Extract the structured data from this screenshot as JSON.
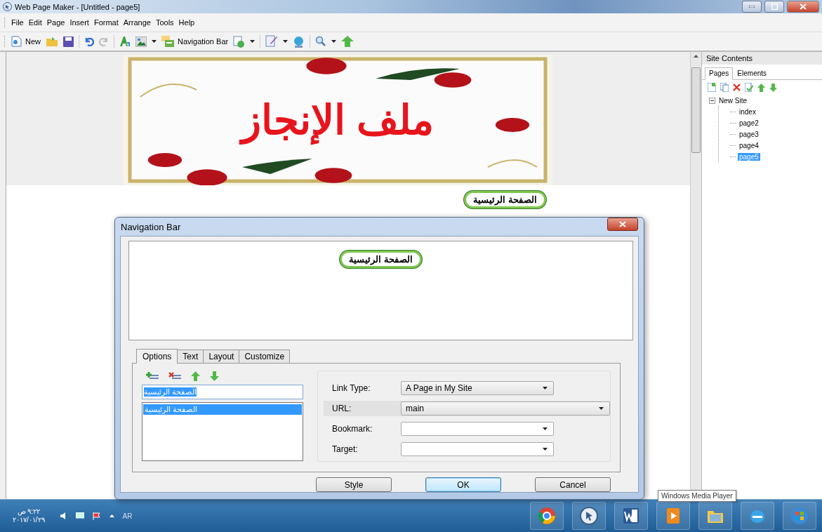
{
  "window": {
    "title": "Web Page Maker - [Untitled - page5]"
  },
  "menu": [
    "File",
    "Edit",
    "Page",
    "Insert",
    "Format",
    "Arrange",
    "Tools",
    "Help"
  ],
  "toolbar": {
    "new_label": "New",
    "navbar_label": "Navigation Bar"
  },
  "page": {
    "banner_title": "ملف الإنجاز",
    "nav_button": "الصفحة الرئيسية"
  },
  "site_panel": {
    "title": "Site Contents",
    "tabs": [
      {
        "label": "Pages",
        "selected": true
      },
      {
        "label": "Elements",
        "selected": false
      }
    ],
    "tree": [
      {
        "label": "New Site",
        "expanded": true,
        "selected": false,
        "children": [
          {
            "label": "index",
            "selected": false
          },
          {
            "label": "page2",
            "selected": false
          },
          {
            "label": "page3",
            "selected": false
          },
          {
            "label": "page4",
            "selected": false
          },
          {
            "label": "page5",
            "selected": true
          }
        ]
      }
    ]
  },
  "dialog": {
    "title": "Navigation Bar",
    "preview_button": "الصفحة الرئيسية",
    "tabs": [
      {
        "label": "Options",
        "selected": true
      },
      {
        "label": "Text",
        "selected": false
      },
      {
        "label": "Layout",
        "selected": false
      },
      {
        "label": "Customize",
        "selected": false
      }
    ],
    "item_field": {
      "value": "الصفحة الرئيسية"
    },
    "items": [
      {
        "label": "الصفحة الرئيسية",
        "selected": true
      }
    ],
    "fields": [
      {
        "label": "Link Type:",
        "value": "A Page in My Site",
        "highlighted": false
      },
      {
        "label": "URL:",
        "value": "main",
        "highlighted": true
      },
      {
        "label": "Bookmark:",
        "highlighted": false
      },
      {
        "label": "Target:",
        "highlighted": false
      }
    ],
    "buttons": [
      {
        "label": "Style",
        "default": false
      },
      {
        "label": "OK",
        "default": true
      },
      {
        "label": "Cancel",
        "default": false
      }
    ]
  },
  "taskbar": {
    "time": "٩:٢٢ ص",
    "date": "٢٠١٧/٠١/٢٩",
    "language": "AR",
    "tooltip": "Windows Media Player"
  }
}
